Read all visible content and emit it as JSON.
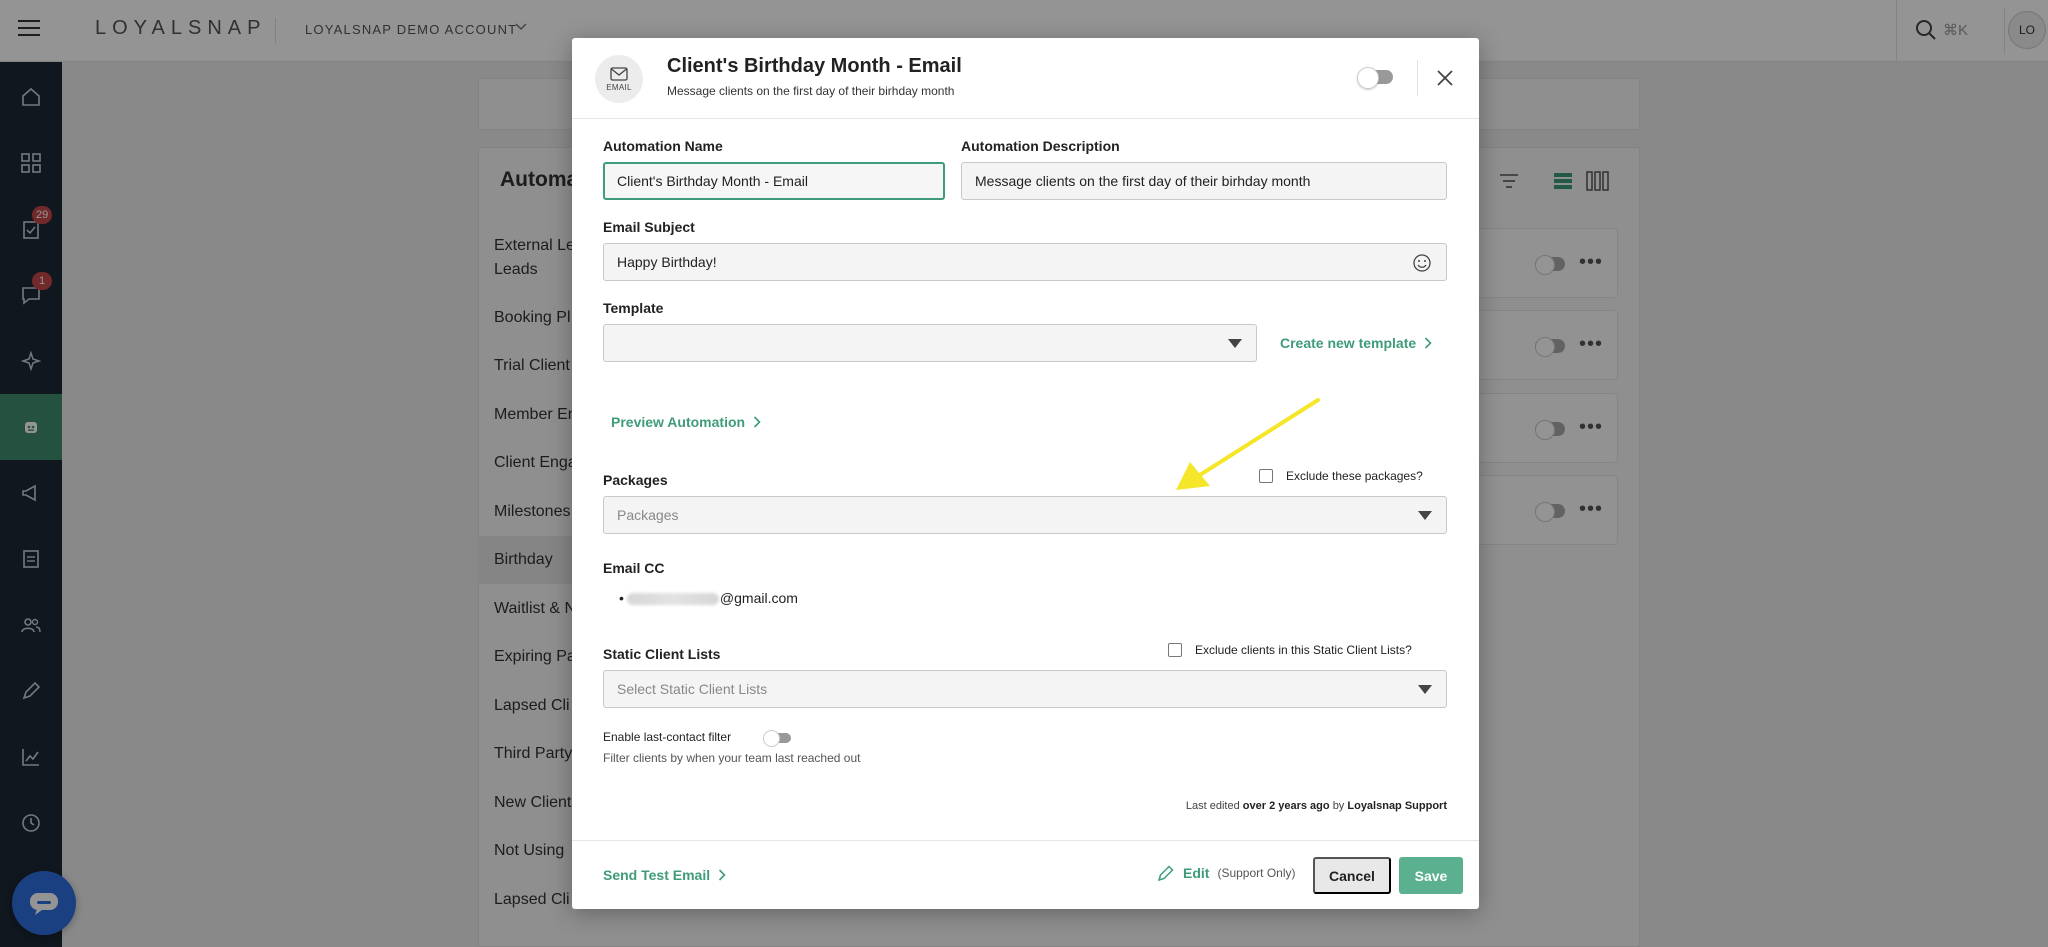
{
  "topbar": {
    "brand": "LOYALSNAP",
    "account": "LOYALSNAP DEMO ACCOUNT",
    "search_shortcut": "⌘K",
    "avatar_initials": "LO"
  },
  "sidebar": {
    "badges": {
      "tasks": "29",
      "messages": "1"
    }
  },
  "background": {
    "section_title": "Automa",
    "list": [
      "External Le",
      "Leads",
      "Booking Pl",
      "Trial Client",
      "Member En",
      "Client Enga",
      "Milestones",
      "Birthday",
      "Waitlist & N",
      "Expiring Pa",
      "Lapsed Cli",
      "Third Party",
      "New Client",
      "Not Using",
      "Lapsed Cli"
    ]
  },
  "modal": {
    "badge_label": "EMAIL",
    "title": "Client's Birthday Month - Email",
    "subtitle": "Message clients on the first day of their birhday month",
    "automation_name_label": "Automation Name",
    "automation_name_value": "Client's Birthday Month - Email",
    "automation_description_label": "Automation Description",
    "automation_description_value": "Message clients on the first day of their birhday month",
    "email_subject_label": "Email Subject",
    "email_subject_value": "Happy Birthday!",
    "template_label": "Template",
    "template_value": "",
    "create_template_link": "Create new template",
    "preview_link": "Preview Automation",
    "packages_label": "Packages",
    "packages_placeholder": "Packages",
    "exclude_packages_label": "Exclude these packages?",
    "email_cc_label": "Email CC",
    "email_cc_bullet": "•",
    "email_cc_domain": "@gmail.com",
    "static_lists_label": "Static Client Lists",
    "static_lists_placeholder": "Select Static Client Lists",
    "exclude_static_label": "Exclude clients in this Static Client Lists?",
    "last_contact_label": "Enable last-contact filter",
    "last_contact_hint": "Filter clients by when your team last reached out",
    "last_edited_prefix": "Last edited",
    "last_edited_when": "over 2 years ago",
    "last_edited_by_word": "by",
    "last_edited_by": "Loyalsnap Support",
    "send_test_link": "Send Test Email",
    "edit_label": "Edit",
    "edit_note": "(Support Only)",
    "cancel_label": "Cancel",
    "save_label": "Save"
  },
  "colors": {
    "accent_green": "#3f9c78",
    "save_button": "#5bb08f",
    "sidebar_bg": "#1d2836",
    "annotation_arrow": "#f5e62a"
  }
}
